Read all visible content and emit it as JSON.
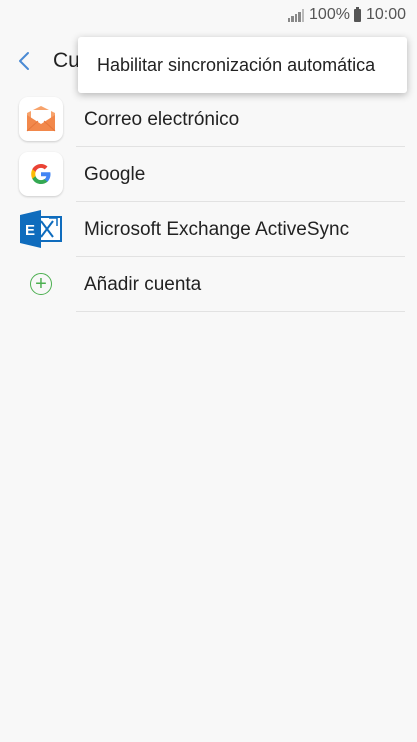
{
  "statusbar": {
    "battery_pct": "100%",
    "time": "10:00"
  },
  "header": {
    "title": "Cu",
    "back_icon": "chevron-left-icon"
  },
  "popup_menu": {
    "items": [
      {
        "label": "Habilitar sincronización automática"
      }
    ]
  },
  "accounts": [
    {
      "label": "Correo electrónico",
      "icon": "email-envelope-icon",
      "color": "#f2884b"
    },
    {
      "label": "Google",
      "icon": "google-logo-icon",
      "color": "#4285f4"
    },
    {
      "label": "Microsoft Exchange ActiveSync",
      "icon": "exchange-logo-icon",
      "color": "#0f6cbd"
    },
    {
      "label": "Añadir cuenta",
      "icon": "plus-circle-icon",
      "color": "#4caf50"
    }
  ]
}
